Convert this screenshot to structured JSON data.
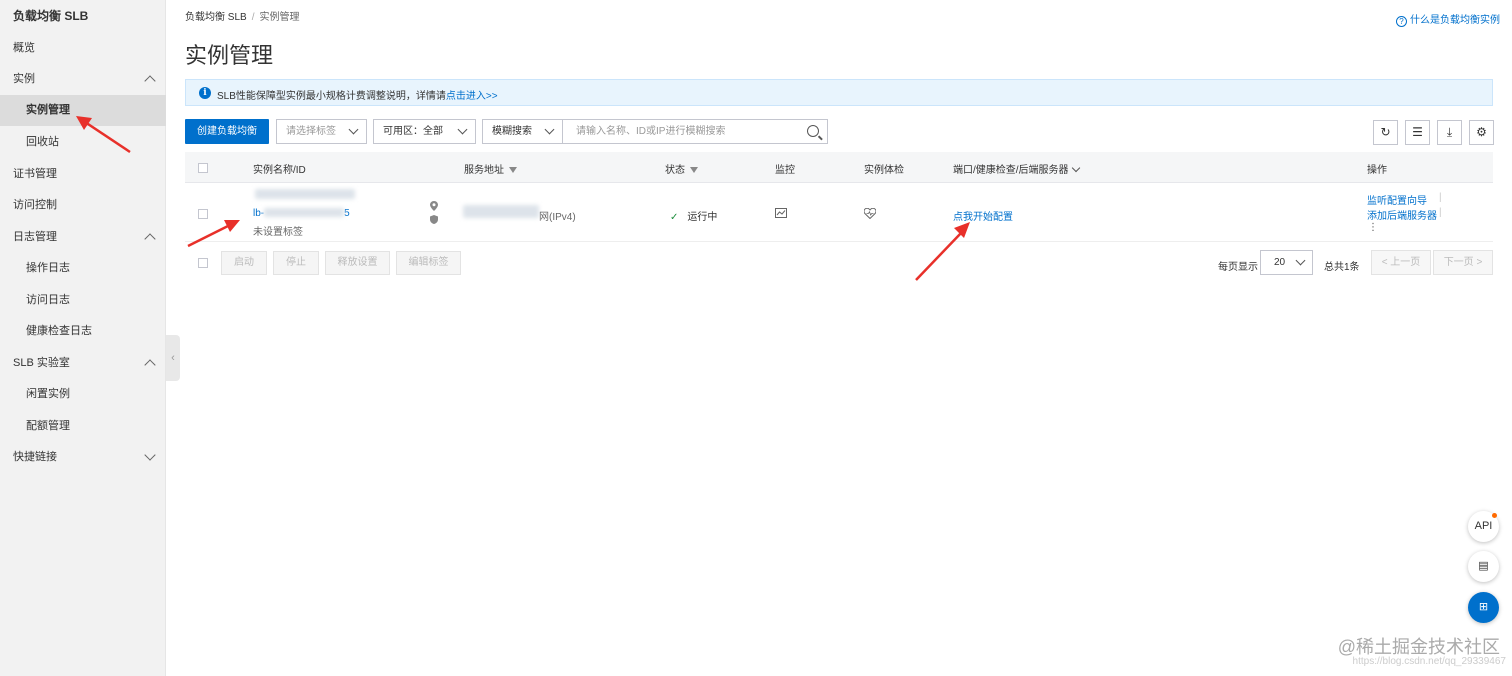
{
  "sidebar": {
    "title": "负载均衡 SLB",
    "items": [
      {
        "label": "概览"
      },
      {
        "label": "实例"
      },
      {
        "label": "实例管理"
      },
      {
        "label": "回收站"
      },
      {
        "label": "证书管理"
      },
      {
        "label": "访问控制"
      },
      {
        "label": "日志管理"
      },
      {
        "label": "操作日志"
      },
      {
        "label": "访问日志"
      },
      {
        "label": "健康检查日志"
      },
      {
        "label": "SLB 实验室"
      },
      {
        "label": "闲置实例"
      },
      {
        "label": "配额管理"
      },
      {
        "label": "快捷链接"
      }
    ]
  },
  "breadcrumb": {
    "root": "负载均衡 SLB",
    "sep": "/",
    "current": "实例管理"
  },
  "help": {
    "qmark": "?",
    "label": "什么是负载均衡实例"
  },
  "page": {
    "title": "实例管理"
  },
  "notice": {
    "icon": "i",
    "text": "SLB性能保障型实例最小规格计费调整说明，详情请",
    "link": "点击进入>>"
  },
  "toolbar": {
    "create_label": "创建负载均衡",
    "tag_placeholder": "请选择标签",
    "zone_label": "可用区：全部",
    "search_mode": "模糊搜索",
    "search_placeholder": "请输入名称、ID或IP进行模糊搜索",
    "icons": {
      "refresh": "↻",
      "list": "☰",
      "download": "⤓",
      "settings": "⚙"
    }
  },
  "table": {
    "headers": {
      "name": "实例名称/ID",
      "address": "服务地址",
      "status": "状态",
      "monitor": "监控",
      "health": "实例体检",
      "port": "端口/健康检查/后端服务器",
      "ops": "操作"
    },
    "row": {
      "id_prefix": "lb-",
      "id_suffix": "5",
      "tag": "未设置标签",
      "address_suffix": "网(IPv4)",
      "status_check": "✓",
      "status": "运行中",
      "port_action": "点我开始配置",
      "op1": "监听配置向导",
      "op2": "添加后端服务器",
      "op_more": "⋮",
      "op_sep": "|"
    }
  },
  "bulk_actions": {
    "start": "启动",
    "stop": "停止",
    "release": "释放设置",
    "edit_tag": "编辑标签"
  },
  "pager": {
    "per_page_label": "每页显示",
    "per_page_value": "20",
    "total": "总共1条",
    "prev": "< 上一页",
    "next": "下一页 >"
  },
  "floating": {
    "api": "API",
    "chat": "▤",
    "apps": "⊞"
  },
  "watermark": {
    "main": "@稀土掘金技术社区",
    "sub": "https://blog.csdn.net/qq_29339467"
  }
}
